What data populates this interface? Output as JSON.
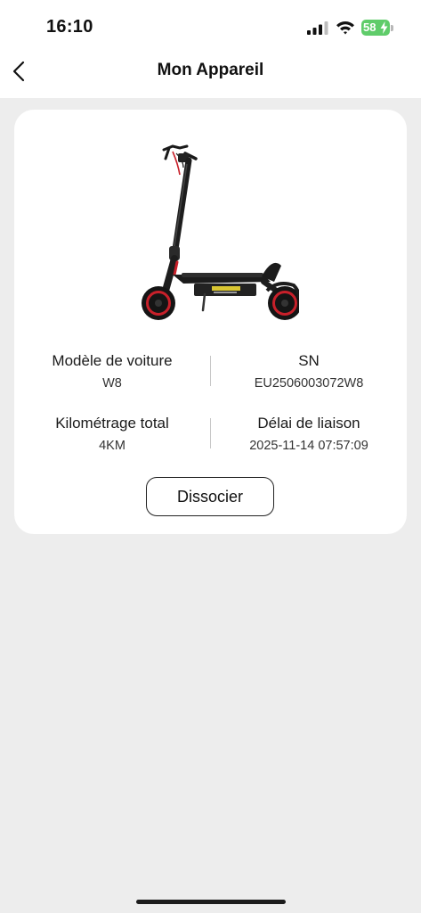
{
  "status_bar": {
    "time": "16:10",
    "battery_level": "58",
    "battery_charging": true,
    "battery_color": "#5fcc6a"
  },
  "nav": {
    "title": "Mon Appareil",
    "back_icon": "chevron-left-icon"
  },
  "device": {
    "image": "electric-scooter",
    "model_label": "Modèle de voiture",
    "model_value": "W8",
    "sn_label": "SN",
    "sn_value": "EU2506003072W8",
    "mileage_label": "Kilométrage total",
    "mileage_value": "4KM",
    "binding_label": "Délai de liaison",
    "binding_value": "2025-11-14 07:57:09"
  },
  "actions": {
    "dissociate_label": "Dissocier"
  },
  "colors": {
    "background": "#ededed",
    "card": "#ffffff",
    "accent_red": "#c8202a"
  }
}
